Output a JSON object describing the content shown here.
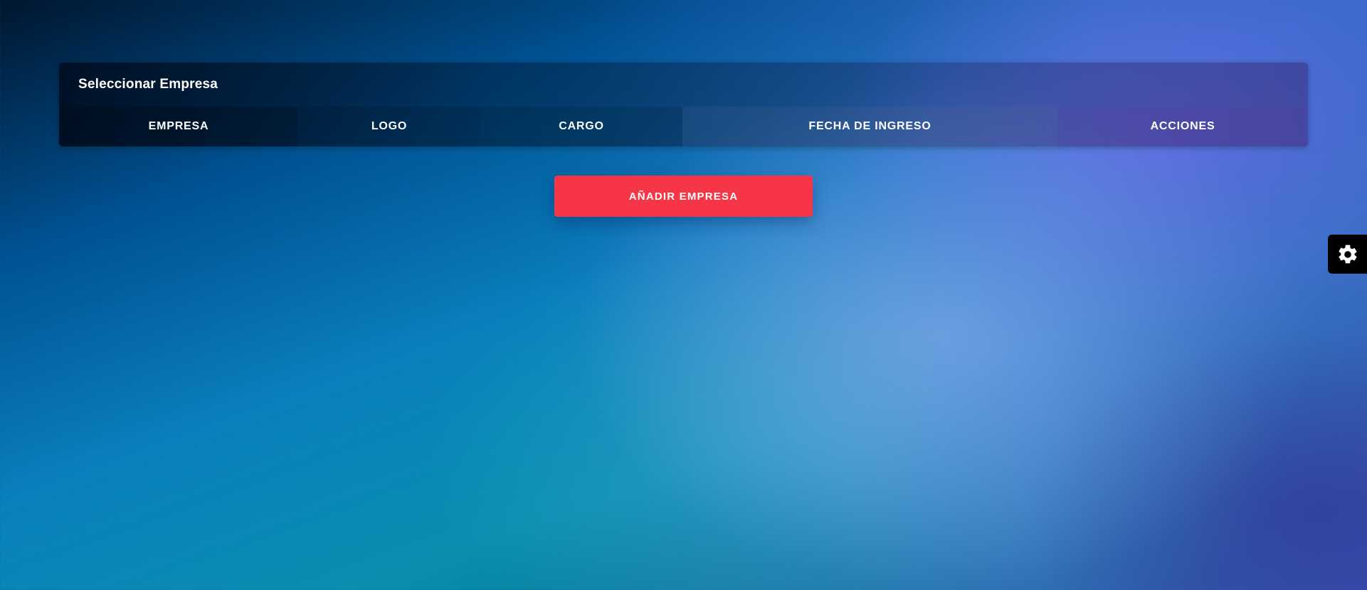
{
  "company_card": {
    "title": "Seleccionar Empresa",
    "columns": [
      "EMPRESA",
      "LOGO",
      "CARGO",
      "FECHA DE INGRESO",
      "ACCIONES"
    ]
  },
  "actions": {
    "add_company_label": "AÑADIR EMPRESA"
  },
  "settings": {
    "icon": "gear-icon"
  },
  "colors": {
    "accent": "#f63646",
    "settings_tab": "#000000"
  }
}
